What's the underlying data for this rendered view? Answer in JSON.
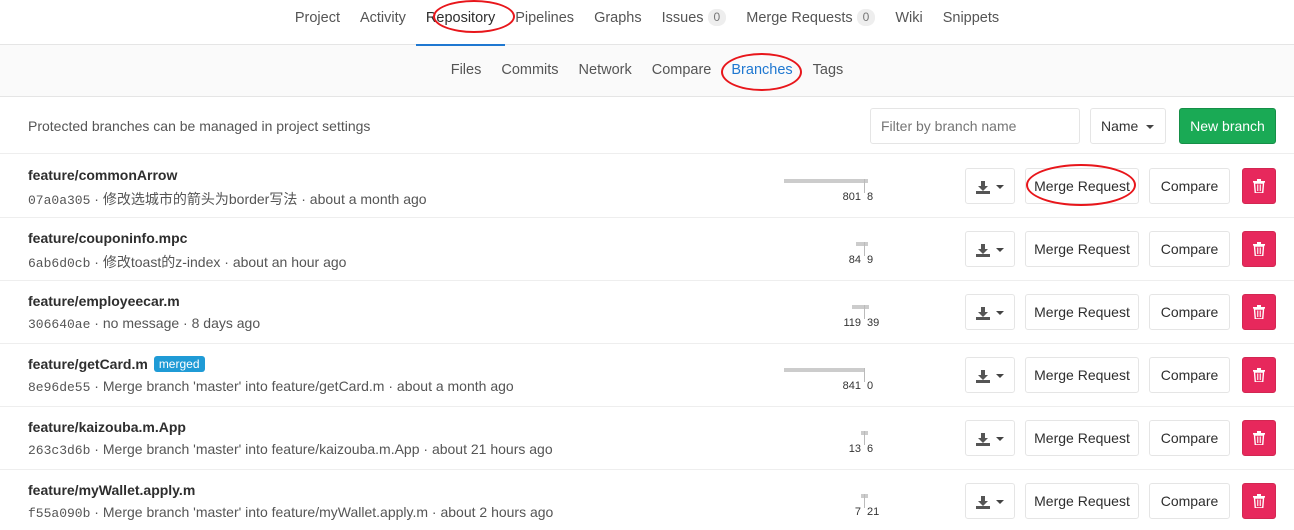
{
  "top_nav": {
    "tabs": [
      {
        "label": "Project"
      },
      {
        "label": "Activity"
      },
      {
        "label": "Repository",
        "active": true
      },
      {
        "label": "Pipelines"
      },
      {
        "label": "Graphs"
      },
      {
        "label": "Issues",
        "count": "0"
      },
      {
        "label": "Merge Requests",
        "count": "0"
      },
      {
        "label": "Wiki"
      },
      {
        "label": "Snippets"
      }
    ]
  },
  "sub_nav": {
    "tabs": [
      {
        "label": "Files"
      },
      {
        "label": "Commits"
      },
      {
        "label": "Network"
      },
      {
        "label": "Compare"
      },
      {
        "label": "Branches",
        "active": true
      },
      {
        "label": "Tags"
      }
    ]
  },
  "controls": {
    "protected_note": "Protected branches can be managed in project settings",
    "filter_placeholder": "Filter by branch name",
    "sort_label": "Name",
    "new_branch_label": "New branch"
  },
  "row_actions": {
    "merge_request_label": "Merge Request",
    "compare_label": "Compare"
  },
  "colors": {
    "accent": "#1f78d1",
    "success": "#1aaa55",
    "danger": "#e7285c",
    "annotation": "#e8161b"
  },
  "branches": [
    {
      "name": "feature/commonArrow",
      "merged": false,
      "sha": "07a0a305",
      "message": "修改选城市的箭头为border写法",
      "time": "about a month ago",
      "behind": "801",
      "ahead": "8"
    },
    {
      "name": "feature/couponinfo.mpc",
      "merged": false,
      "sha": "6ab6d0cb",
      "message": "修改toast的z-index",
      "time": "about an hour ago",
      "behind": "84",
      "ahead": "9"
    },
    {
      "name": "feature/employeecar.m",
      "merged": false,
      "sha": "306640ae",
      "message": "no message",
      "time": "8 days ago",
      "behind": "119",
      "ahead": "39"
    },
    {
      "name": "feature/getCard.m",
      "merged": true,
      "merged_label": "merged",
      "sha": "8e96de55",
      "message": "Merge branch 'master' into feature/getCard.m",
      "time": "about a month ago",
      "behind": "841",
      "ahead": "0"
    },
    {
      "name": "feature/kaizouba.m.App",
      "merged": false,
      "sha": "263c3d6b",
      "message": "Merge branch 'master' into feature/kaizouba.m.App",
      "time": "about 21 hours ago",
      "behind": "13",
      "ahead": "6"
    },
    {
      "name": "feature/myWallet.apply.m",
      "merged": false,
      "sha": "f55a090b",
      "message": "Merge branch 'master' into feature/myWallet.apply.m",
      "time": "about 2 hours ago",
      "behind": "7",
      "ahead": "21"
    }
  ]
}
